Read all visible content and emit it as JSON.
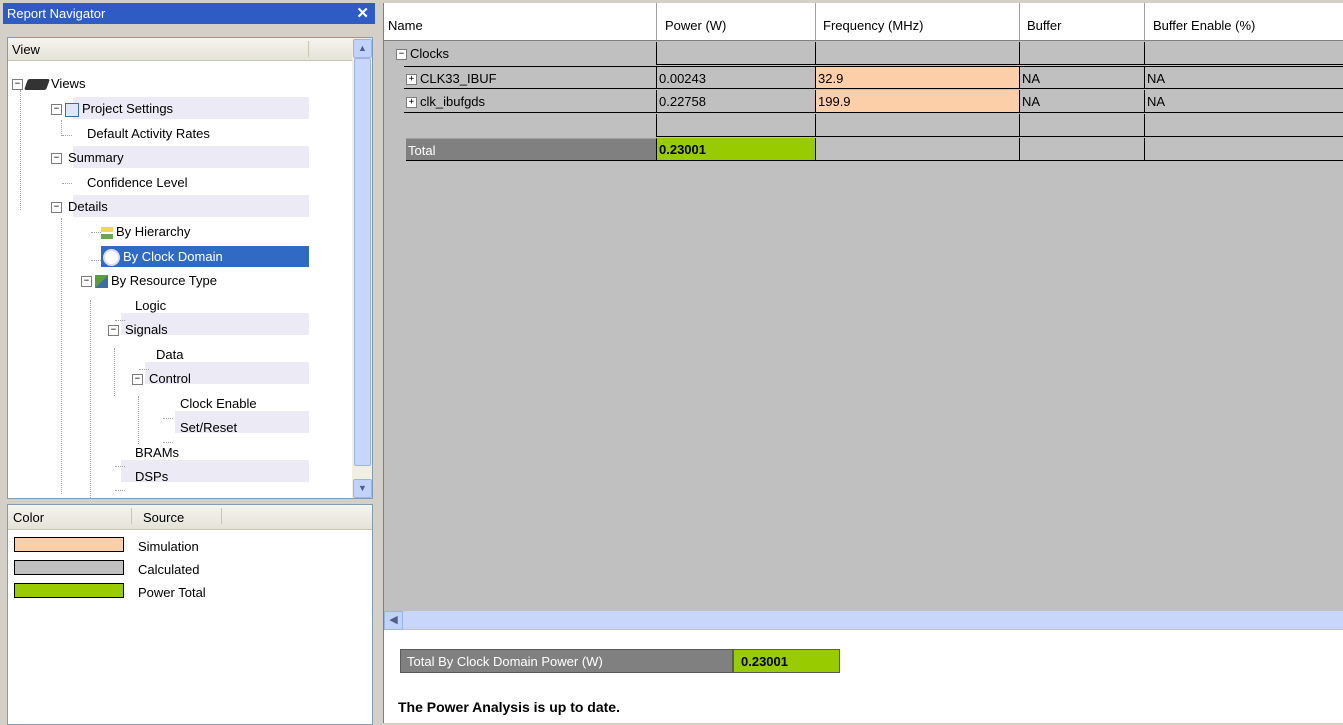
{
  "navigator": {
    "title": "Report Navigator",
    "close": "✕",
    "tree_header": "View",
    "tree": [
      {
        "label": "Views"
      },
      {
        "label": "Project Settings"
      },
      {
        "label": "Default Activity Rates"
      },
      {
        "label": "Summary"
      },
      {
        "label": "Confidence Level"
      },
      {
        "label": "Details"
      },
      {
        "label": "By Hierarchy"
      },
      {
        "label": "By Clock Domain"
      },
      {
        "label": "By Resource Type"
      },
      {
        "label": "Logic"
      },
      {
        "label": "Signals"
      },
      {
        "label": "Data"
      },
      {
        "label": "Control"
      },
      {
        "label": "Clock Enable"
      },
      {
        "label": "Set/Reset"
      },
      {
        "label": "BRAMs"
      },
      {
        "label": "DSPs"
      }
    ]
  },
  "legend": {
    "col_color": "Color",
    "col_source": "Source",
    "items": [
      {
        "label": "Simulation",
        "color": "#fdcfa8"
      },
      {
        "label": "Calculated",
        "color": "#c0c0c0"
      },
      {
        "label": "Power Total",
        "color": "#99cc00"
      }
    ]
  },
  "grid": {
    "columns": [
      "Name",
      "Power (W)",
      "Frequency (MHz)",
      "Buffer",
      "Buffer Enable (%)"
    ],
    "group_label": "Clocks",
    "rows": [
      {
        "name": "CLK33_IBUF",
        "power": "0.00243",
        "freq": "32.9",
        "buffer": "NA",
        "enable": "NA"
      },
      {
        "name": "clk_ibufgds",
        "power": "0.22758",
        "freq": "199.9",
        "buffer": "NA",
        "enable": "NA"
      }
    ],
    "total_label": "Total",
    "total_value": "0.23001"
  },
  "footer": {
    "total_label": "Total By Clock Domain Power (W)",
    "total_value": "0.23001",
    "status": "The Power Analysis is up to date."
  },
  "colors": {
    "selection": "#316ac5",
    "simulation": "#fdcfa8",
    "power_total": "#99cc00",
    "titlebar": "#2e5cc4"
  }
}
